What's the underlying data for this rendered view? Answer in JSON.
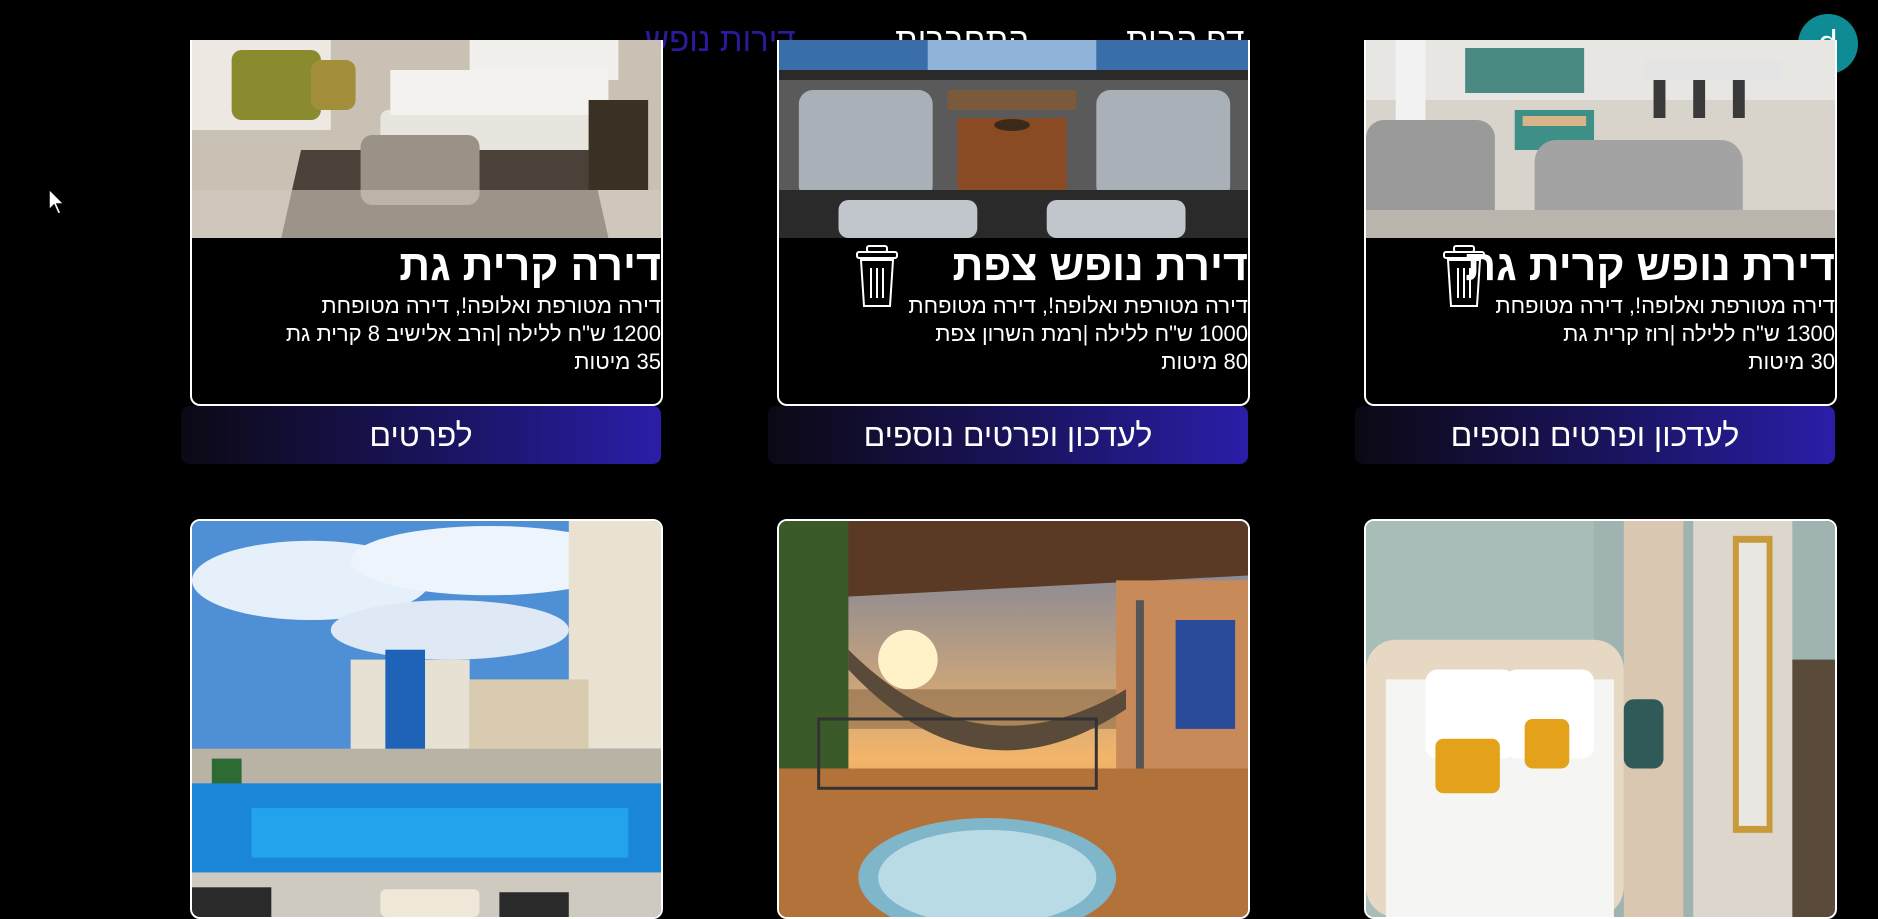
{
  "nav": {
    "home": "דף הבית",
    "login": "התחברות",
    "vacation": "דירות נופש",
    "avatar_letter": "d"
  },
  "cards": [
    {
      "title": "דירת נופש קרית גת",
      "desc_line1": "דירה מטורפת ואלופה!, דירה מטופחת",
      "desc_line2": "1300 ש\"ח ללילה |רוז קרית גת",
      "desc_line3": "30 מיטות",
      "button": "לעדכון ופרטים נוספים"
    },
    {
      "title": "דירת נופש צפת",
      "desc_line1": "דירה מטורפת ואלופה!, דירה מטופחת",
      "desc_line2": "1000 ש\"ח ללילה |רמת השרון צפת",
      "desc_line3": "80 מיטות",
      "button": "לעדכון ופרטים נוספים"
    },
    {
      "title": "דירה קרית גת",
      "desc_line1": "דירה מטורפת ואלופה!, דירה מטופחת",
      "desc_line2": "1200 ש\"ח ללילה |הרב אלישיב 8 קרית גת",
      "desc_line3": "35 מיטות",
      "button": "לפרטים"
    }
  ],
  "icons": {
    "trash": "trash-icon",
    "cursor": "mouse-pointer-icon"
  },
  "colors": {
    "background": "#000000",
    "nav_active": "#2a1a9e",
    "avatar": "#0f8c93",
    "button_gradient_end": "#2a1ea8"
  }
}
